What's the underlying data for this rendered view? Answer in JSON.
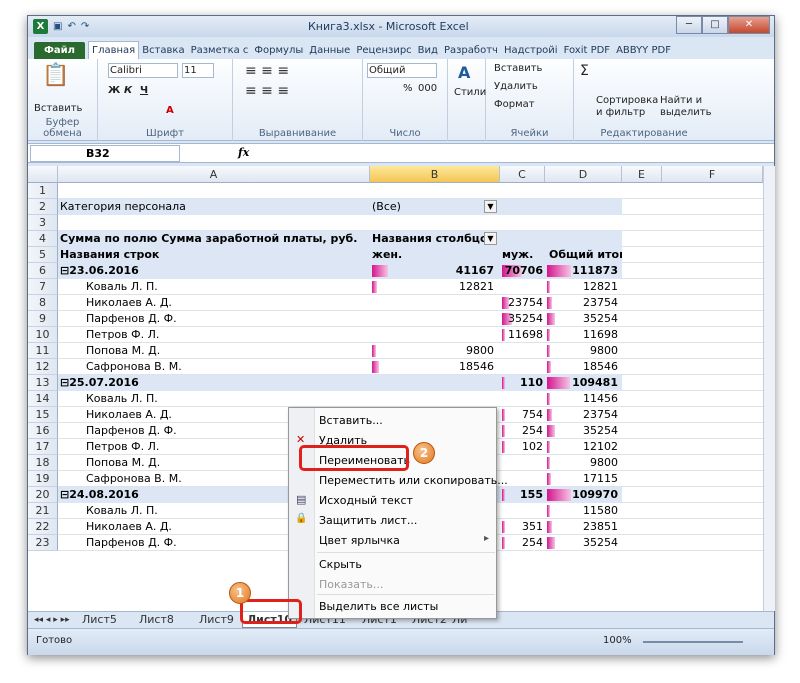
{
  "window": {
    "title": "Книга3.xlsx - Microsoft Excel",
    "min": "─",
    "max": "□",
    "close": "✕"
  },
  "ribbon_tabs": [
    "Файл",
    "Главная",
    "Вставка",
    "Разметка с",
    "Формулы",
    "Данные",
    "Рецензирс",
    "Вид",
    "Разработч",
    "Надстройі",
    "Foxit PDF",
    "ABBYY PDF"
  ],
  "ribbon": {
    "paste": "Вставить",
    "clipboard": "Буфер обмена",
    "font_name": "Calibri",
    "font_size": "11",
    "bold": "Ж",
    "italic": "К",
    "underline": "Ч",
    "font": "Шрифт",
    "alignment": "Выравнивание",
    "number_format": "Общий",
    "number": "Число",
    "styles": "Стили",
    "insert": "Вставить",
    "delete": "Удалить",
    "format": "Формат",
    "cells": "Ячейки",
    "sort": "Сортировка",
    "sort2": "и фильтр",
    "find": "Найти и",
    "find2": "выделить",
    "editing": "Редактирование",
    "sigma": "Σ",
    "pct": "%",
    "thou": "000"
  },
  "formula_bar": {
    "cell_ref": "B32",
    "fx": "fx",
    "value": ""
  },
  "columns": [
    "A",
    "B",
    "C",
    "D",
    "E",
    "F"
  ],
  "rows": [
    {
      "n": "1"
    },
    {
      "n": "2",
      "a": "Категория персонала",
      "b": "(Все)",
      "filter": true,
      "blue": true
    },
    {
      "n": "3"
    },
    {
      "n": "4",
      "a": "Сумма по полю Сумма заработной платы, руб.",
      "b": "Названия столбцов",
      "bold": true,
      "blue": true,
      "filter": true
    },
    {
      "n": "5",
      "a": "Названия строк",
      "b": "жен.",
      "c": "муж.",
      "d": "Общий итог",
      "bold": true,
      "blue": true
    },
    {
      "n": "6",
      "a": "⊟23.06.2016",
      "b": "41167",
      "c": "70706",
      "d": "111873",
      "bold": true,
      "blue": true
    },
    {
      "n": "7",
      "a": "Коваль Л. П.",
      "b": "12821",
      "d": "12821",
      "ind": true
    },
    {
      "n": "8",
      "a": "Николаев А. Д.",
      "c": "23754",
      "d": "23754",
      "ind": true
    },
    {
      "n": "9",
      "a": "Парфенов Д. Ф.",
      "c": "35254",
      "d": "35254",
      "ind": true
    },
    {
      "n": "10",
      "a": "Петров Ф. Л.",
      "c": "11698",
      "d": "11698",
      "ind": true
    },
    {
      "n": "11",
      "a": "Попова М. Д.",
      "b": "9800",
      "d": "9800",
      "ind": true
    },
    {
      "n": "12",
      "a": "Сафронова В. М.",
      "b": "18546",
      "d": "18546",
      "ind": true
    },
    {
      "n": "13",
      "a": "⊟25.07.2016",
      "c": "110",
      "d": "109481",
      "bold": true,
      "blue": true
    },
    {
      "n": "14",
      "a": "Коваль Л. П.",
      "d": "11456",
      "ind": true
    },
    {
      "n": "15",
      "a": "Николаев А. Д.",
      "c": "754",
      "d": "23754",
      "ind": true
    },
    {
      "n": "16",
      "a": "Парфенов Д. Ф.",
      "c": "254",
      "d": "35254",
      "ind": true
    },
    {
      "n": "17",
      "a": "Петров Ф. Л.",
      "c": "102",
      "d": "12102",
      "ind": true
    },
    {
      "n": "18",
      "a": "Попова М. Д.",
      "d": "9800",
      "ind": true
    },
    {
      "n": "19",
      "a": "Сафронова В. М.",
      "d": "17115",
      "ind": true
    },
    {
      "n": "20",
      "a": "⊟24.08.2016",
      "c": "155",
      "d": "109970",
      "bold": true,
      "blue": true
    },
    {
      "n": "21",
      "a": "Коваль Л. П.",
      "d": "11580",
      "ind": true
    },
    {
      "n": "22",
      "a": "Николаев А. Д.",
      "c": "351",
      "d": "23851",
      "ind": true
    },
    {
      "n": "23",
      "a": "Парфенов Д. Ф.",
      "c": "254",
      "d": "35254",
      "ind": true
    }
  ],
  "sheet_tabs": [
    "Лист5",
    "Лист8",
    "Лист9",
    "Лист10",
    "Лист11",
    "Лист1",
    "Лист2",
    "Ли"
  ],
  "active_sheet": "Лист10",
  "context_menu": [
    "Вставить...",
    "Удалить",
    "Переименовать",
    "Переместить или скопировать...",
    "Исходный текст",
    "Защитить лист...",
    "Цвет ярлычка",
    "Скрыть",
    "Показать...",
    "Выделить все листы"
  ],
  "status": {
    "ready": "Готово",
    "zoom": "100%"
  },
  "badges": {
    "one": "1",
    "two": "2"
  }
}
